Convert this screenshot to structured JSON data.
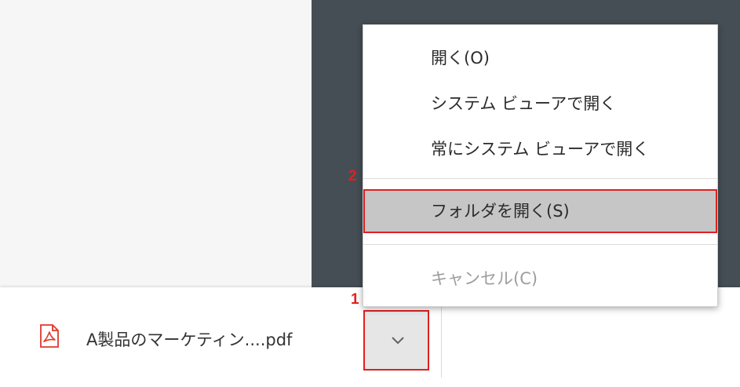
{
  "menu": {
    "items": [
      {
        "label": "開く(O)"
      },
      {
        "label": "システム ビューアで開く"
      },
      {
        "label": "常にシステム ビューアで開く"
      },
      {
        "label": "フォルダを開く(S)"
      },
      {
        "label": "キャンセル(C)"
      }
    ]
  },
  "download": {
    "file_name": "A製品のマーケティン....pdf",
    "file_icon": "pdf-icon",
    "arrow_icon": "chevron-down-icon"
  },
  "annotations": {
    "step1": "1",
    "step2": "2"
  },
  "colors": {
    "highlight_border": "#e02020",
    "menu_highlight": "#c6c6c6",
    "pdf_icon": "#e0372b"
  }
}
